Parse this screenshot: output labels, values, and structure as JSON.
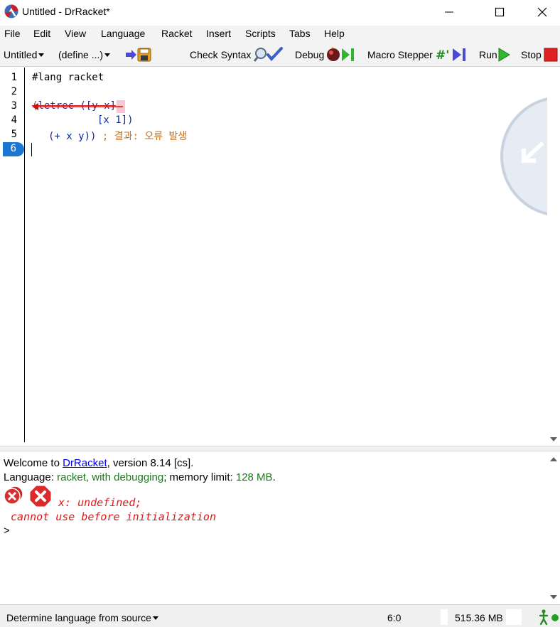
{
  "window": {
    "title": "Untitled - DrRacket*",
    "minimize": "minimize",
    "maximize": "maximize",
    "close": "close"
  },
  "menu": [
    "File",
    "Edit",
    "View",
    "Language",
    "Racket",
    "Insert",
    "Scripts",
    "Tabs",
    "Help"
  ],
  "toolbar": {
    "file_name": "Untitled",
    "define": "(define ...)",
    "check_syntax": "Check Syntax",
    "debug": "Debug",
    "macro_stepper": "Macro Stepper",
    "run": "Run",
    "stop": "Stop"
  },
  "editor": {
    "line_numbers": [
      "1",
      "2",
      "3",
      "4",
      "5",
      "6"
    ],
    "current_line": "6",
    "lines": {
      "l1": "#lang racket",
      "l3_open": "(",
      "l3_kw": "letrec ([y x]",
      "l4": "[x 1])",
      "l5_code": "(+ x y))",
      "l5_comment": "; 결과: 오류 발생"
    }
  },
  "repl": {
    "welcome_prefix": "Welcome to ",
    "welcome_link": "DrRacket",
    "welcome_suffix": ", version 8.14 [cs].",
    "lang_prefix": "Language: ",
    "lang_value": "racket, with debugging",
    "lang_mid": "; memory limit: ",
    "mem_value": "128 MB",
    "lang_end": ".",
    "error_line1": "x: undefined;",
    "error_line2": "cannot use before initialization",
    "prompt": ">"
  },
  "status": {
    "language_select": "Determine language from source",
    "position": "6:0",
    "memory": "515.36 MB"
  },
  "colors": {
    "accent_blue": "#1a78d4",
    "error_red": "#e01818",
    "green": "#1a7a1a",
    "comment_orange": "#c2741f"
  }
}
